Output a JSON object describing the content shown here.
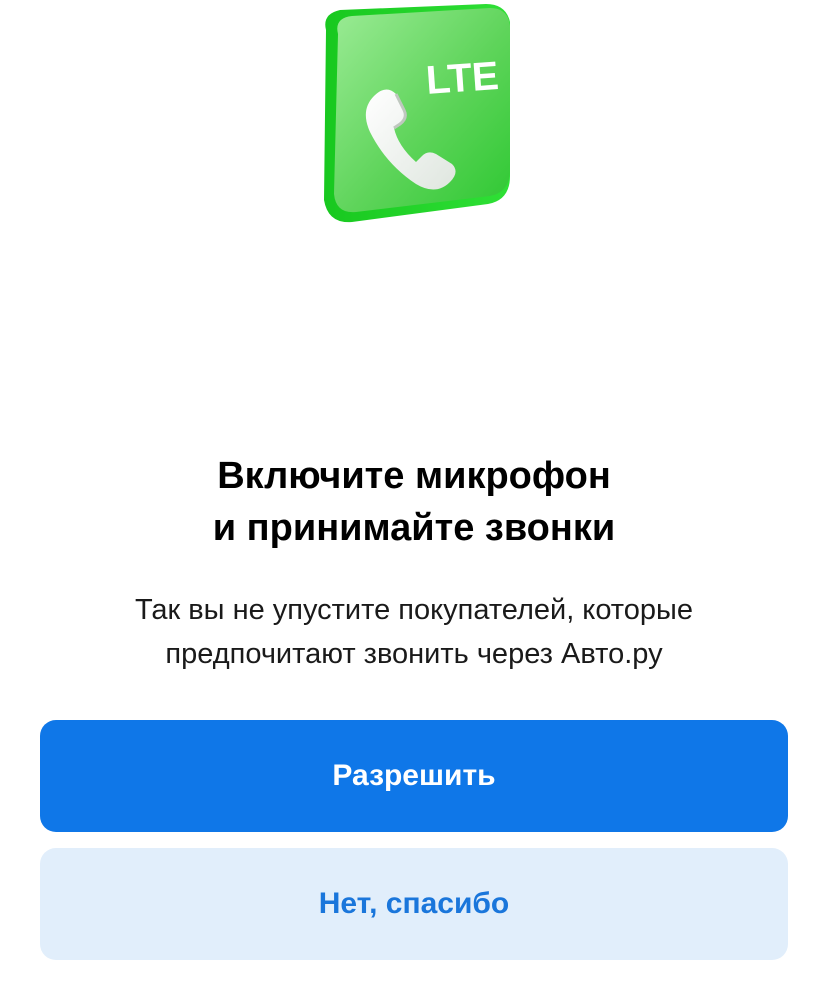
{
  "hero": {
    "icon": "lte-phone-icon",
    "badge_text": "LTE",
    "colors": {
      "green_light": "#8be38a",
      "green_dark": "#1fcf2a"
    }
  },
  "dialog": {
    "title_line1": "Включите микрофон",
    "title_line2": "и принимайте звонки",
    "subtitle_line1": "Так вы не упустите покупателей, которые",
    "subtitle_line2": "предпочитают звонить через Авто.ру"
  },
  "actions": {
    "allow_label": "Разрешить",
    "decline_label": "Нет, спасибо"
  },
  "colors": {
    "primary": "#0f77e8",
    "secondary_bg": "#e1eefb",
    "secondary_text": "#1a76db"
  }
}
